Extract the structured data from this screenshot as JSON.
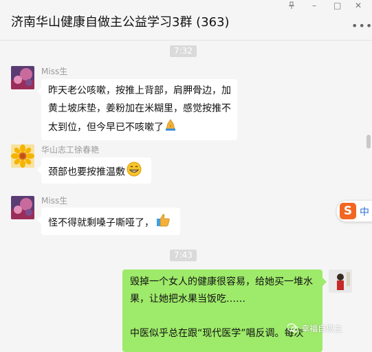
{
  "window": {
    "title": "济南华山健康自做主公益学习3群 (363)",
    "pin_icon": "pin-icon",
    "minimize_glyph": "–",
    "maximize_glyph": "□",
    "close_glyph": "✕",
    "more_glyph": "•••"
  },
  "messages": [
    {
      "kind": "time",
      "text": "7:32"
    },
    {
      "kind": "incoming",
      "sender": "Miss生",
      "avatar": "avatar-purple-flower",
      "text": "昨天老公咳嗽，按推上背部，肩胛骨边，加黄土坡床垫，姜粉加在米糊里，感觉按推不太到位，但今早已不咳嗽了",
      "emoji": "praying-hands-icon"
    },
    {
      "kind": "incoming",
      "sender": "华山志工徐春艳",
      "avatar": "avatar-yellow-flower",
      "text": "颈部也要按推温敷",
      "emoji": "grinning-face-icon"
    },
    {
      "kind": "incoming",
      "sender": "Miss生",
      "avatar": "avatar-purple-flower",
      "text": "怪不得就剩嗓子嘶哑了，",
      "emoji": "thumbs-up-icon"
    },
    {
      "kind": "time",
      "text": "7:43"
    },
    {
      "kind": "outgoing",
      "avatar": "avatar-person-red-coat",
      "text_lines": [
        "毁掉一个女人的健康很容易，给她买一堆水果，让她把水果当饭吃……",
        "",
        "中医似乎总在跟“现代医学”唱反调。每次"
      ]
    }
  ],
  "ime": {
    "badge_char": "S",
    "label": "中"
  },
  "watermark": {
    "text": "幸福自做主",
    "icon": "wechat-official-icon"
  },
  "colors": {
    "background": "#f5f5f5",
    "bubble_in": "#ffffff",
    "bubble_out": "#9eea6a",
    "time_badge": "#dadada",
    "name_text": "#999999",
    "ime_accent": "#f26522"
  }
}
